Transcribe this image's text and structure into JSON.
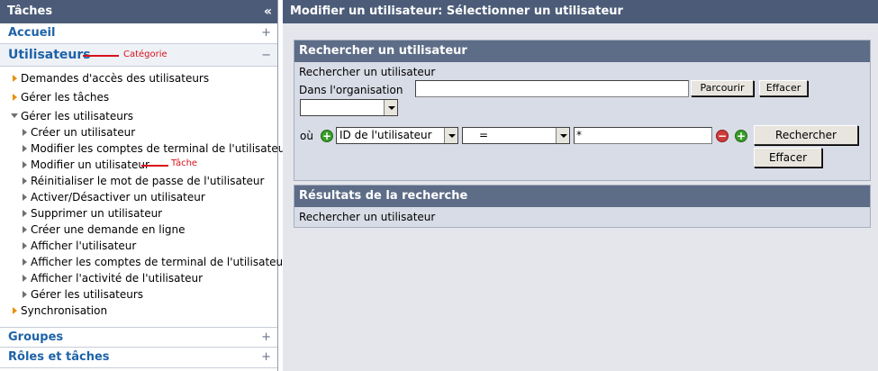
{
  "left": {
    "header": {
      "title": "Tâches",
      "collapse_glyph": "«"
    },
    "categories_top": [
      {
        "label": "Accueil",
        "toggle": "+"
      }
    ],
    "open_category": {
      "label": "Utilisateurs",
      "toggle": "−",
      "annotation": "Catégorie"
    },
    "tree": {
      "top_items": [
        "Demandes d'accès des utilisateurs",
        "Gérer les tâches"
      ],
      "expanded_group": "Gérer les utilisateurs",
      "sub_items": [
        "Créer un utilisateur",
        "Modifier les comptes de terminal de l'utilisateur",
        "Modifier un utilisateur",
        "Réinitialiser le mot de passe de l'utilisateur",
        "Activer/Désactiver un utilisateur",
        "Supprimer un utilisateur",
        "Créer une demande en ligne",
        "Afficher l'utilisateur",
        "Afficher les comptes de terminal de l'utilisateur",
        "Afficher l'activité de l'utilisateur",
        "Gérer les utilisateurs"
      ],
      "task_annotation": "Tâche",
      "last_item": "Synchronisation"
    },
    "categories_bottom": [
      {
        "label": "Groupes",
        "toggle": "+"
      },
      {
        "label": "Rôles et tâches",
        "toggle": "+"
      }
    ]
  },
  "main": {
    "title": "Modifier un utilisateur: Sélectionner un utilisateur",
    "search_box": {
      "header": "Rechercher un utilisateur",
      "subtitle": "Rechercher un utilisateur",
      "org_label": "Dans l'organisation",
      "org_value": "",
      "browse_button": "Parcourir",
      "clear_org_button": "Effacer",
      "org_select_value": "",
      "where_label": "où",
      "field_select": "ID de l'utilisateur",
      "operator_select": "=",
      "criteria_value": "*",
      "search_button": "Rechercher",
      "clear_button": "Effacer"
    },
    "results_box": {
      "header": "Résultats de la recherche",
      "text": "Rechercher un utilisateur"
    }
  }
}
